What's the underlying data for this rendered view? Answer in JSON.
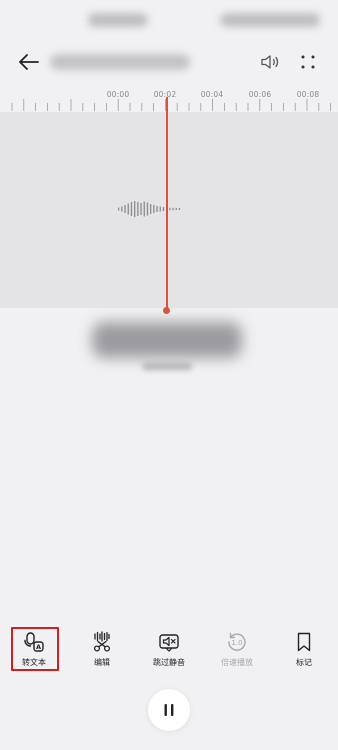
{
  "ruler": {
    "ticks": [
      "00:00",
      "00:02",
      "00:04",
      "00:06",
      "00:08"
    ]
  },
  "playhead_color": "#d9513f",
  "toolbar": {
    "items": [
      {
        "icon": "voice-to-text-icon",
        "label": "转文本",
        "enabled": true
      },
      {
        "icon": "edit-scissors-icon",
        "label": "编辑",
        "enabled": true
      },
      {
        "icon": "skip-silence-icon",
        "label": "跳过静音",
        "enabled": true
      },
      {
        "icon": "speed-playback-icon",
        "label": "倍速播放",
        "enabled": false
      },
      {
        "icon": "bookmark-icon",
        "label": "标记",
        "enabled": true
      }
    ]
  },
  "highlight_color": "#d11f1f"
}
